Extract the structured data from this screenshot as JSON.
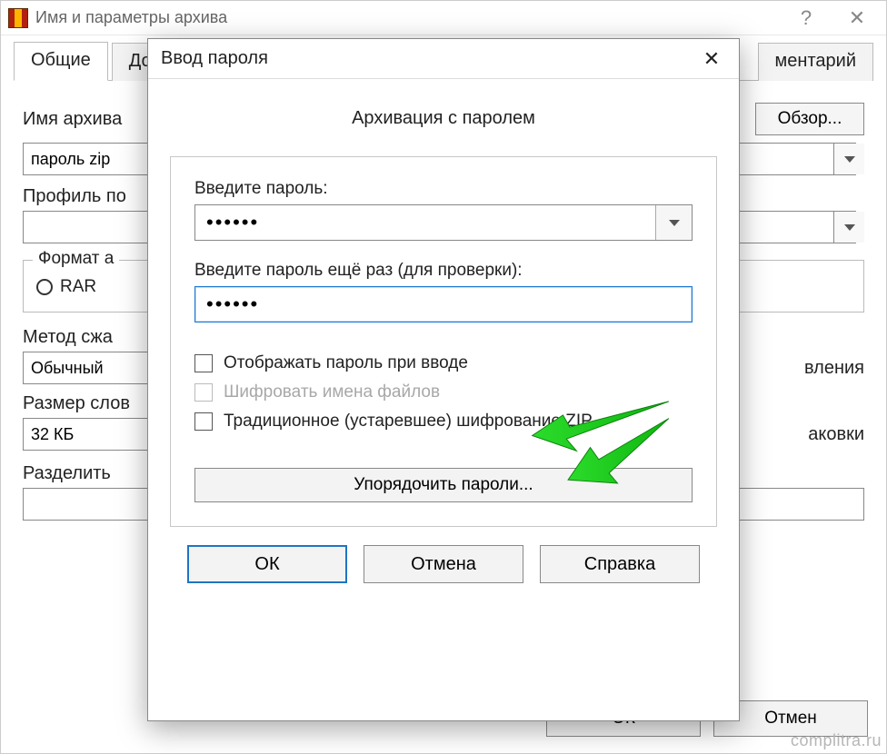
{
  "bgwin": {
    "title": "Имя и параметры архива",
    "tabs": {
      "general": "Общие",
      "extra": "Доп",
      "comment_clip": "ментарий"
    },
    "labels": {
      "archive_name": "Имя архива",
      "profile": "Профиль по",
      "format_group": "Формат а",
      "rar": "RAR",
      "method": "Метод сжа",
      "dict": "Размер слов",
      "split": "Разделить",
      "right_update": "вления",
      "right_pack": "аковки"
    },
    "values": {
      "archive_name": "пароль zip",
      "method": "Обычный",
      "dict": "32 КБ"
    },
    "buttons": {
      "browse": "Обзор...",
      "ok": "ОК",
      "cancel": "Отмен"
    }
  },
  "modal": {
    "title": "Ввод пароля",
    "subtitle": "Архивация с паролем",
    "labels": {
      "enter": "Введите пароль:",
      "repeat": "Введите пароль ещё раз (для проверки):"
    },
    "values": {
      "password": "••••••",
      "password_repeat": "••••••"
    },
    "checks": {
      "show": "Отображать пароль при вводе",
      "encrypt_names": "Шифровать имена файлов",
      "legacy_zip": "Традиционное (устаревшее) шифрование ZIP"
    },
    "buttons": {
      "organize": "Упорядочить пароли...",
      "ok": "ОК",
      "cancel": "Отмена",
      "help": "Справка"
    }
  },
  "watermark": "complitra.ru"
}
